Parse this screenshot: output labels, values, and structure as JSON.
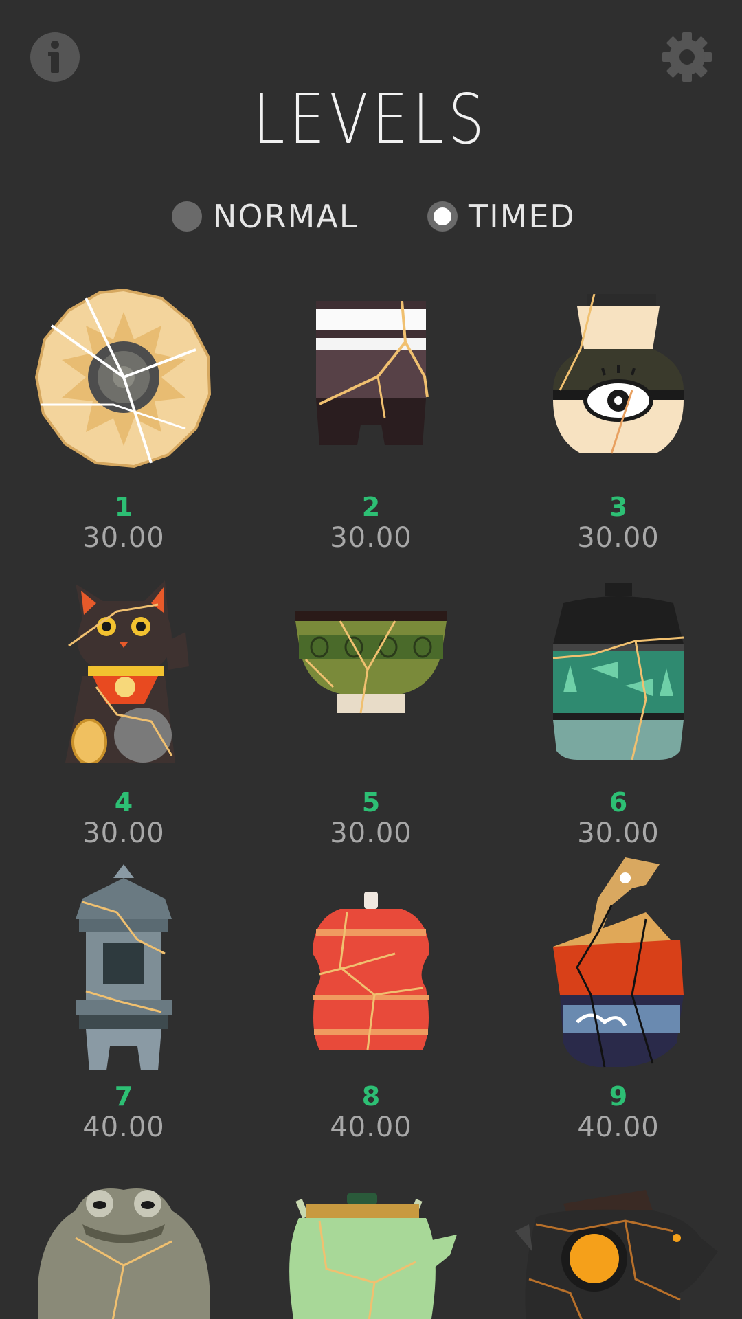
{
  "header": {
    "title": "LEVELS",
    "info_icon": "info-icon",
    "settings_icon": "gear-icon"
  },
  "modes": {
    "options": [
      {
        "label": "NORMAL",
        "selected": false
      },
      {
        "label": "TIMED",
        "selected": true
      }
    ]
  },
  "levels": [
    {
      "number": "1",
      "time": "30.00",
      "art": "golden-plate"
    },
    {
      "number": "2",
      "time": "30.00",
      "art": "striped-cup"
    },
    {
      "number": "3",
      "time": "30.00",
      "art": "eye-vase"
    },
    {
      "number": "4",
      "time": "30.00",
      "art": "lucky-cat"
    },
    {
      "number": "5",
      "time": "30.00",
      "art": "green-bowl"
    },
    {
      "number": "6",
      "time": "30.00",
      "art": "fish-jar"
    },
    {
      "number": "7",
      "time": "40.00",
      "art": "stone-lantern"
    },
    {
      "number": "8",
      "time": "40.00",
      "art": "red-jar"
    },
    {
      "number": "9",
      "time": "40.00",
      "art": "bird-vessel"
    },
    {
      "art": "frog"
    },
    {
      "art": "teapot"
    },
    {
      "art": "boar"
    }
  ],
  "colors": {
    "background": "#2f2f2f",
    "level_number": "#2dbf74",
    "level_time": "#a8a8a8",
    "kintsugi_gold": "#f0c070"
  }
}
